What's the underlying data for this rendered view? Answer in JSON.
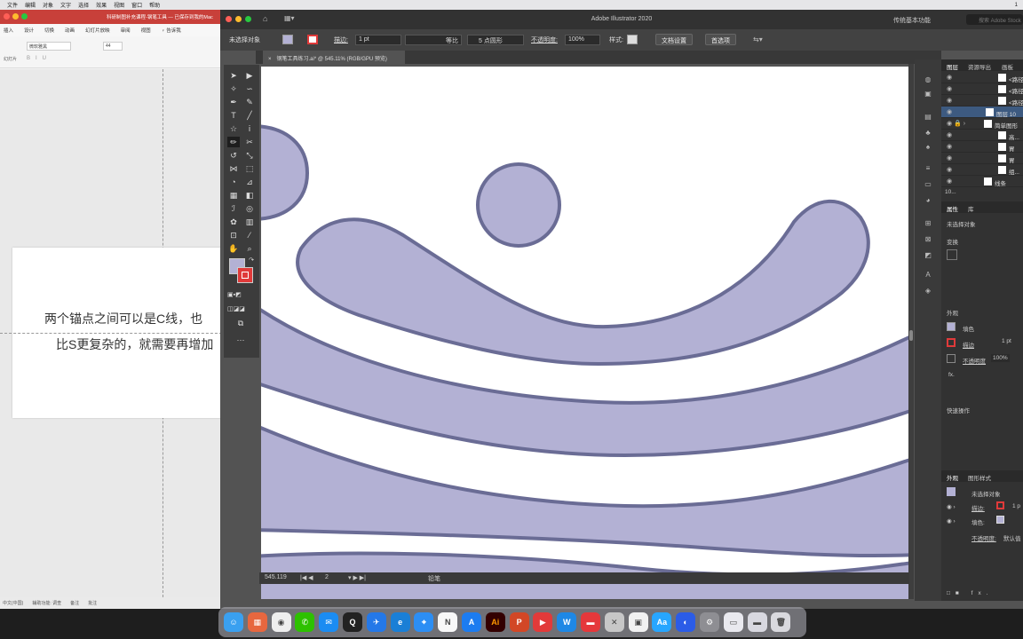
{
  "mac_menubar": {
    "items": [
      "文件",
      "编辑",
      "对象",
      "文字",
      "选择",
      "效果",
      "视图",
      "窗口",
      "帮助"
    ],
    "right_text": "1"
  },
  "ppt": {
    "title": "科研制图补充课程-钢笔工具 — 已保存到我的Mac",
    "menu": [
      "插入",
      "设计",
      "切换",
      "动画",
      "幻灯片放映",
      "审阅",
      "视图",
      "♀ 告诉我"
    ],
    "font_name": "微软雅黑",
    "font_size": "44",
    "ribbon_left_label": "幻灯片",
    "slide_text_1": "两个锚点之间可以是C线，也",
    "slide_text_2": "比S更复杂的，就需要再增加",
    "status": [
      "中文(中国)",
      "辅助功能: 调查",
      "备注",
      "批注"
    ]
  },
  "ai": {
    "window_title": "Adobe Illustrator 2020",
    "workspace": "传统基本功能",
    "search_placeholder": "搜索 Adobe Stock",
    "control": {
      "no_selection": "未选择对象",
      "stroke_label": "描边:",
      "stroke_value": "1 pt",
      "profile_label": "等比",
      "brush_label": "5 点圆形",
      "opacity_label": "不透明度:",
      "opacity_value": "100%",
      "style_label": "样式:",
      "doc_setup": "文档设置",
      "prefs": "首选项"
    },
    "tab_title": "钢笔工具练习.ai* @ 545.11% (RGB/GPU 预览)",
    "status": {
      "zoom": "545.119",
      "artboard": "2",
      "tool": "铅笔"
    },
    "colors": {
      "fill": "#b3b1d4",
      "stroke": "#6a6c95",
      "stroke_swatch": "#e03a3a"
    },
    "layers_panel": {
      "tabs": [
        "图层",
        "资源导出",
        "画板"
      ],
      "rows": [
        "<路径>",
        "<路径>",
        "<路径>",
        "图层 10",
        "简单图形",
        "高...",
        "胃",
        "胃",
        "组...",
        "线条"
      ],
      "count": "10..."
    },
    "properties_panel": {
      "tabs": [
        "属性",
        "库"
      ],
      "no_selection": "未选择对象",
      "transform": "变换",
      "appearance": "外观",
      "fill_label": "填色",
      "stroke_label": "描边",
      "stroke_value": "1 pt",
      "opacity_label": "不透明度",
      "opacity_value": "100%",
      "fx": "fx.",
      "quick_actions": "快速操作"
    },
    "appearance_panel": {
      "tabs": [
        "外观",
        "图形样式"
      ],
      "no_selection": "未选择对象",
      "stroke_label": "描边:",
      "stroke_value": "1 p",
      "fill_label": "填色:",
      "opacity_label": "不透明度:",
      "opacity_value": "默认值"
    }
  },
  "dock_apps": [
    {
      "name": "finder",
      "color": "#3aa0f0",
      "glyph": "☺"
    },
    {
      "name": "launchpad",
      "color": "#e7673f",
      "glyph": "▦"
    },
    {
      "name": "chrome",
      "color": "#eeeeee",
      "glyph": "◉"
    },
    {
      "name": "wechat",
      "color": "#2dc100",
      "glyph": "✆"
    },
    {
      "name": "messages",
      "color": "#1b8cf2",
      "glyph": "✉"
    },
    {
      "name": "qq",
      "color": "#222222",
      "glyph": "Q"
    },
    {
      "name": "mail",
      "color": "#2478e8",
      "glyph": "✈"
    },
    {
      "name": "edge",
      "color": "#1a7fd6",
      "glyph": "e"
    },
    {
      "name": "safari",
      "color": "#2c8ef4",
      "glyph": "⌖"
    },
    {
      "name": "notion",
      "color": "#f8f8f8",
      "glyph": "N"
    },
    {
      "name": "appstore",
      "color": "#1c7cf0",
      "glyph": "A"
    },
    {
      "name": "illustrator",
      "color": "#330000",
      "glyph": "Ai"
    },
    {
      "name": "powerpoint",
      "color": "#d24726",
      "glyph": "P"
    },
    {
      "name": "video",
      "color": "#e23a3a",
      "glyph": "▶"
    },
    {
      "name": "wps",
      "color": "#1e88e5",
      "glyph": "W"
    },
    {
      "name": "sticky",
      "color": "#e5383b",
      "glyph": "▬"
    },
    {
      "name": "excel-like",
      "color": "#c7c7c7",
      "glyph": "✕"
    },
    {
      "name": "preview",
      "color": "#f1f1f1",
      "glyph": "▣"
    },
    {
      "name": "ai-chat",
      "color": "#27a6ff",
      "glyph": "Aa"
    },
    {
      "name": "browser",
      "color": "#2b5ce7",
      "glyph": "◐"
    },
    {
      "name": "settings",
      "color": "#8e8e93",
      "glyph": "⚙"
    },
    {
      "name": "downloads",
      "color": "#e9e9ef",
      "glyph": "▭"
    },
    {
      "name": "folder",
      "color": "#d8d8e0",
      "glyph": "▬"
    },
    {
      "name": "trash",
      "color": "#d9d9de",
      "glyph": "🗑"
    }
  ]
}
